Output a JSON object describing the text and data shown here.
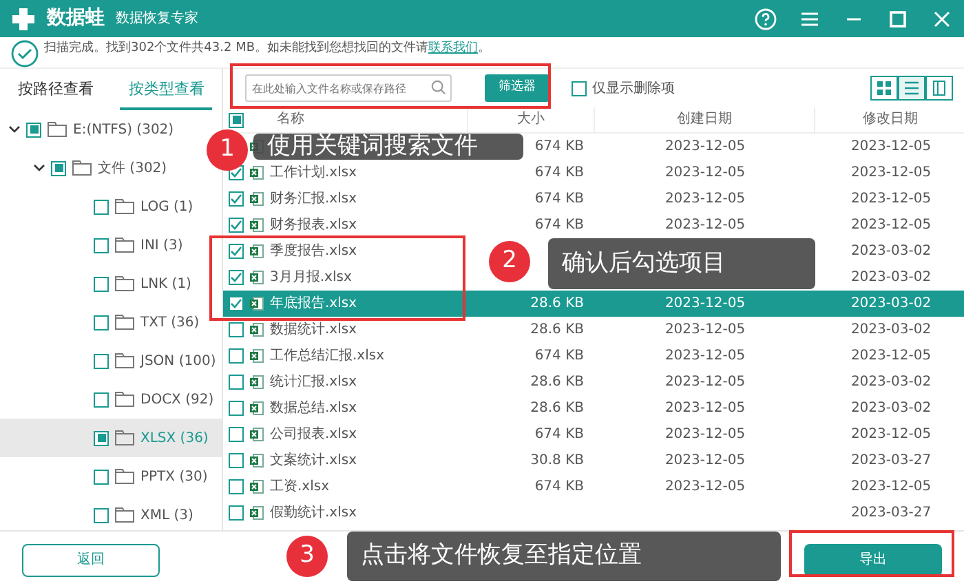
{
  "app": {
    "logo_text": "数据蛙",
    "subtitle": "数据恢复专家"
  },
  "scan_notice": {
    "text": "扫描完成。找到302个文件共43.2 MB。如未能找到您想找回的文件请",
    "link": "联系我们",
    "end": "。"
  },
  "view_tabs": [
    {
      "label": "按路径查看",
      "selected": false
    },
    {
      "label": "按类型查看",
      "selected": true
    }
  ],
  "tree": [
    {
      "label": "E:(NTFS) (302)",
      "partial": true,
      "expanded": true,
      "selected": false,
      "children": [
        {
          "label": "文件 (302)",
          "partial": true,
          "expanded": true,
          "selected": false,
          "children": [
            {
              "label": "LOG (1)",
              "partial": false,
              "selected": false
            },
            {
              "label": "INI (3)",
              "partial": false,
              "selected": false
            },
            {
              "label": "LNK (1)",
              "partial": false,
              "selected": false
            },
            {
              "label": "TXT (36)",
              "partial": false,
              "selected": false
            },
            {
              "label": "JSON (100)",
              "partial": false,
              "selected": false
            },
            {
              "label": "DOCX (92)",
              "partial": false,
              "selected": false
            },
            {
              "label": "XLSX (36)",
              "partial": true,
              "selected": true
            },
            {
              "label": "PPTX (30)",
              "partial": false,
              "selected": false
            },
            {
              "label": "XML (3)",
              "partial": false,
              "selected": false
            }
          ]
        }
      ]
    }
  ],
  "search": {
    "placeholder": "在此处输入文件名称或保存路径"
  },
  "filter_button": "筛选器",
  "deleted_only": {
    "label": "仅显示删除项",
    "checked": false
  },
  "view_modes": [
    {
      "selected": false
    },
    {
      "selected": true
    },
    {
      "selected": false
    }
  ],
  "table": {
    "select_all_partial": true,
    "columns": [
      "名称",
      "大小",
      "创建日期",
      "修改日期"
    ],
    "rows": [
      {
        "selected": false,
        "size": "674 KB",
        "created": "2023-12-05",
        "modified": "2023-12-05"
      },
      {
        "checked": true,
        "selected": false,
        "name": "工作计划.xlsx",
        "size": "674 KB",
        "created": "2023-12-05",
        "modified": "2023-12-05"
      },
      {
        "checked": true,
        "selected": false,
        "name": "财务汇报.xlsx",
        "size": "674 KB",
        "created": "2023-12-05",
        "modified": "2023-12-05"
      },
      {
        "checked": true,
        "selected": false,
        "name": "财务报表.xlsx",
        "size": "674 KB",
        "created": "2023-12-05",
        "modified": "2023-12-05"
      },
      {
        "checked": true,
        "selected": false,
        "name": "季度报告.xlsx",
        "modified": "2023-03-02"
      },
      {
        "checked": true,
        "selected": false,
        "name": "3月月报.xlsx",
        "modified": "2023-03-02"
      },
      {
        "checked": true,
        "selected": true,
        "name": "年底报告.xlsx",
        "size": "28.6 KB",
        "created": "2023-12-05",
        "modified": "2023-03-02"
      },
      {
        "checked": false,
        "selected": false,
        "name": "数据统计.xlsx",
        "size": "28.6 KB",
        "created": "2023-12-05",
        "modified": "2023-03-02"
      },
      {
        "checked": false,
        "selected": false,
        "name": "工作总结汇报.xlsx",
        "size": "674 KB",
        "created": "2023-12-05",
        "modified": "2023-12-05"
      },
      {
        "checked": false,
        "selected": false,
        "name": "统计汇报.xlsx",
        "size": "28.6 KB",
        "created": "2023-12-05",
        "modified": "2023-03-02"
      },
      {
        "checked": false,
        "selected": false,
        "name": "数据总结.xlsx",
        "size": "28.6 KB",
        "created": "2023-12-05",
        "modified": "2023-03-02"
      },
      {
        "checked": false,
        "selected": false,
        "name": "公司报表.xlsx",
        "size": "674 KB",
        "created": "2023-12-05",
        "modified": "2023-12-05"
      },
      {
        "checked": false,
        "selected": false,
        "name": "文案统计.xlsx",
        "size": "30.8 KB",
        "created": "2023-12-05",
        "modified": "2023-03-27"
      },
      {
        "checked": false,
        "selected": false,
        "name": "工资.xlsx",
        "size": "674 KB",
        "created": "2023-12-05",
        "modified": "2023-12-05"
      },
      {
        "checked": false,
        "selected": false,
        "name": "假勤统计.xlsx",
        "modified": "2023-03-27"
      }
    ]
  },
  "back_button": "返回",
  "export_button": "导出",
  "callouts": [
    {
      "number": "1",
      "text": "使用关键词搜索文件"
    },
    {
      "number": "2",
      "text": "确认后勾选项目"
    },
    {
      "number": "3",
      "text": "点击将文件恢复至指定位置"
    }
  ]
}
